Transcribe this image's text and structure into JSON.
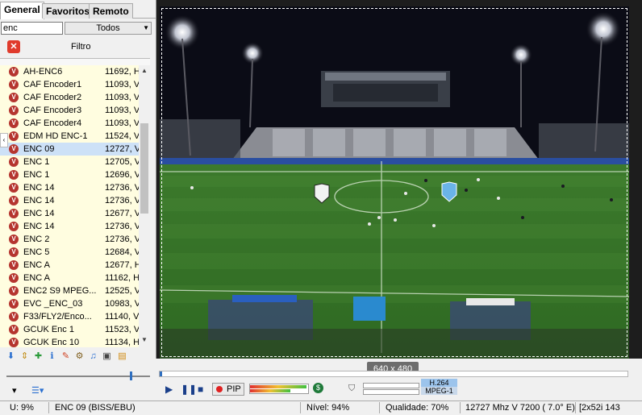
{
  "tabs": [
    "General",
    "Favoritos",
    "Remoto"
  ],
  "search": {
    "value": "enc"
  },
  "filter_combo": {
    "value": "Todos"
  },
  "filter_label": "Filtro",
  "channels": [
    {
      "name": "AH-ENC6",
      "freq": "11692, H,"
    },
    {
      "name": "CAF Encoder1",
      "freq": "11093, V,"
    },
    {
      "name": "CAF Encoder2",
      "freq": "11093, V,"
    },
    {
      "name": "CAF Encoder3",
      "freq": "11093, V,"
    },
    {
      "name": "CAF Encoder4",
      "freq": "11093, V,"
    },
    {
      "name": "EDM HD ENC-1",
      "freq": "11524, V,"
    },
    {
      "name": "ENC 09",
      "freq": "12727, V,"
    },
    {
      "name": "ENC 1",
      "freq": "12705, V,"
    },
    {
      "name": "ENC 1",
      "freq": "12696, V,"
    },
    {
      "name": "ENC 14",
      "freq": "12736, V,"
    },
    {
      "name": "ENC 14",
      "freq": "12736, V,"
    },
    {
      "name": "ENC 14",
      "freq": "12677, V,"
    },
    {
      "name": "ENC 14",
      "freq": "12736, V,"
    },
    {
      "name": "ENC 2",
      "freq": "12736, V,"
    },
    {
      "name": "ENC 5",
      "freq": "12684, V,"
    },
    {
      "name": "ENC A",
      "freq": "12677, H,"
    },
    {
      "name": "ENC A",
      "freq": "11162, H,"
    },
    {
      "name": "ENC2 S9 MPEG...",
      "freq": "12525, V,"
    },
    {
      "name": "EVC _ENC_03",
      "freq": "10983, V,"
    },
    {
      "name": "F33/FLY2/Enco...",
      "freq": "11140, V,"
    },
    {
      "name": "GCUK Enc 1",
      "freq": "11523, V,"
    },
    {
      "name": "GCUK Enc 10",
      "freq": "11134, H,"
    }
  ],
  "selected_index": 6,
  "player": {
    "resolution": "640 x 480",
    "pip_label": "PIP",
    "video_codec": "H.264",
    "audio_codec": "MPEG-1"
  },
  "status": {
    "cpu": "U: 9%",
    "channel": "ENC 09 (BISS/EBU)",
    "level": "Nível: 94%",
    "quality": "Qualidade: 70%",
    "tuning": "12727 Mhz  V  7200  ( 7.0° E)",
    "extra": "[2x52i  143"
  },
  "colors": {
    "list_bg": "#fffde0",
    "selected": "#cde1f7",
    "icon_red": "#b5352f",
    "accent_blue": "#2f6fc0"
  }
}
